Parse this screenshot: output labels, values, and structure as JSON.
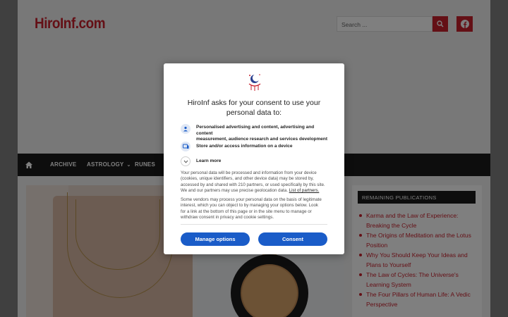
{
  "site": {
    "logo": "HiroInf.com",
    "search_placeholder": "Search ...",
    "brand_color": "#c8202d"
  },
  "nav": {
    "items": [
      {
        "label": "ARCHIVE"
      },
      {
        "label": "ASTROLOGY",
        "has_dropdown": true
      },
      {
        "label": "RUNES"
      }
    ]
  },
  "sidebar": {
    "widget_title": "REMAINING PUBLICATIONS",
    "publications": [
      [
        "Karma and the Law of Experience:",
        "Breaking the Cycle"
      ],
      [
        "The Origins of Meditation and the Lotus",
        "Position"
      ],
      [
        "Why You Should Keep Your Ideas and",
        "Plans to Yourself"
      ],
      [
        "The Law of Cycles: The Universe's",
        "Learning System"
      ],
      [
        "The Four Pillars of Human Life: A Vedic",
        "Perspective"
      ]
    ]
  },
  "consent": {
    "title_line1": "HiroInf asks for your consent to use your",
    "title_line2": "personal data to:",
    "purpose1_line1": "Personalised advertising and content, advertising and content",
    "purpose1_line2": "measurement, audience research and services development",
    "purpose2": "Store and/or access information on a device",
    "learn_more": "Learn more",
    "para1_lines": [
      "Your personal data will be processed and information from your device",
      "(cookies, unique identifiers, and other device data) may be stored by,",
      "accessed by and shared with 210 partners, or used specifically by this site.",
      "We and our partners may use precise geolocation data."
    ],
    "partners_link": "List of partners.",
    "para2_lines": [
      "Some vendors may process your personal data on the basis of legitimate",
      "interest, which you can object to by managing your options below. Look",
      "for a link at the bottom of this page or in the site menu to manage or",
      "withdraw consent in privacy and cookie settings."
    ],
    "manage_button": "Manage options",
    "consent_button": "Consent",
    "button_color": "#1a5cc8"
  },
  "icons": {
    "search": "search-icon",
    "facebook": "facebook-icon",
    "home": "home-icon",
    "person": "person-icon",
    "device": "device-icon",
    "chevron": "chevron-down-icon"
  }
}
